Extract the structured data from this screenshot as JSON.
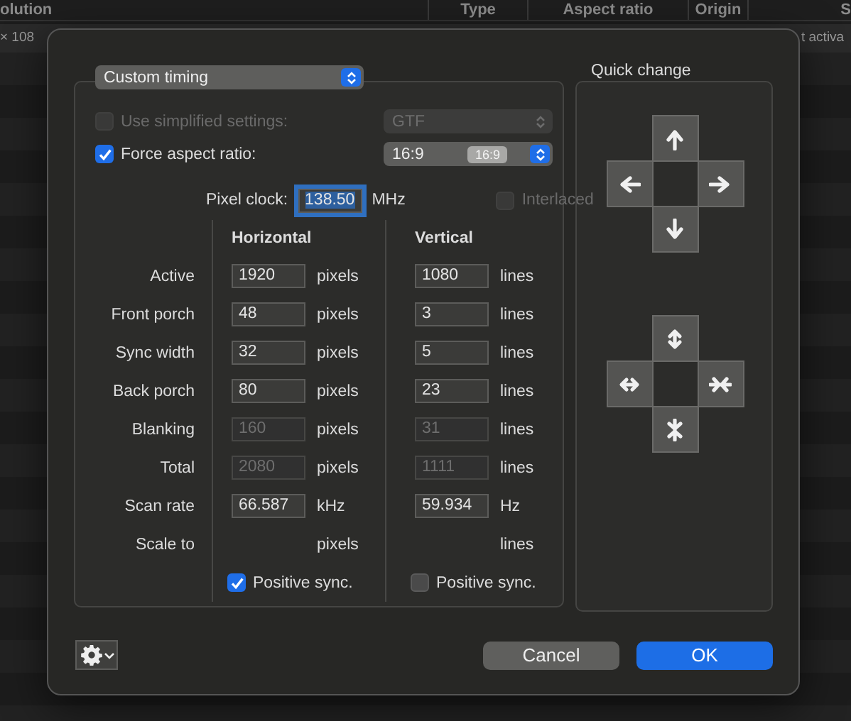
{
  "background_table": {
    "columns": [
      "olution",
      "Type",
      "Aspect ratio",
      "Origin",
      "S"
    ],
    "row": [
      "× 108",
      "t activa"
    ]
  },
  "dialog": {
    "mode_popup": "Custom timing",
    "simplified": {
      "label": "Use simplified settings:",
      "checked": false,
      "popup": "GTF",
      "disabled": true
    },
    "aspect": {
      "label": "Force aspect ratio:",
      "checked": true,
      "popup": "16:9",
      "badge": "16:9"
    },
    "pixel_clock": {
      "label": "Pixel clock:",
      "value": "138.50",
      "unit": "MHz",
      "focused": true
    },
    "interlaced": {
      "label": "Interlaced",
      "checked": false,
      "disabled": true
    },
    "columns": [
      "Horizontal",
      "Vertical"
    ],
    "rows": [
      {
        "label": "Active",
        "h_value": "1920",
        "h_disabled": false,
        "h_unit": "pixels",
        "v_value": "1080",
        "v_disabled": false,
        "v_unit": "lines"
      },
      {
        "label": "Front porch",
        "h_value": "48",
        "h_disabled": false,
        "h_unit": "pixels",
        "v_value": "3",
        "v_disabled": false,
        "v_unit": "lines"
      },
      {
        "label": "Sync width",
        "h_value": "32",
        "h_disabled": false,
        "h_unit": "pixels",
        "v_value": "5",
        "v_disabled": false,
        "v_unit": "lines"
      },
      {
        "label": "Back porch",
        "h_value": "80",
        "h_disabled": false,
        "h_unit": "pixels",
        "v_value": "23",
        "v_disabled": false,
        "v_unit": "lines"
      },
      {
        "label": "Blanking",
        "h_value": "160",
        "h_disabled": true,
        "h_unit": "pixels",
        "v_value": "31",
        "v_disabled": true,
        "v_unit": "lines"
      },
      {
        "label": "Total",
        "h_value": "2080",
        "h_disabled": true,
        "h_unit": "pixels",
        "v_value": "1111",
        "v_disabled": true,
        "v_unit": "lines"
      },
      {
        "label": "Scan rate",
        "h_value": "66.587",
        "h_disabled": false,
        "h_unit": "kHz",
        "v_value": "59.934",
        "v_disabled": false,
        "v_unit": "Hz"
      },
      {
        "label": "Scale to",
        "h_unit": "pixels",
        "v_unit": "lines"
      }
    ],
    "sync": [
      {
        "label": "Positive sync.",
        "checked": true
      },
      {
        "label": "Positive sync.",
        "checked": false
      }
    ],
    "quick_change": {
      "title": "Quick change"
    },
    "buttons": {
      "cancel": "Cancel",
      "ok": "OK"
    }
  }
}
